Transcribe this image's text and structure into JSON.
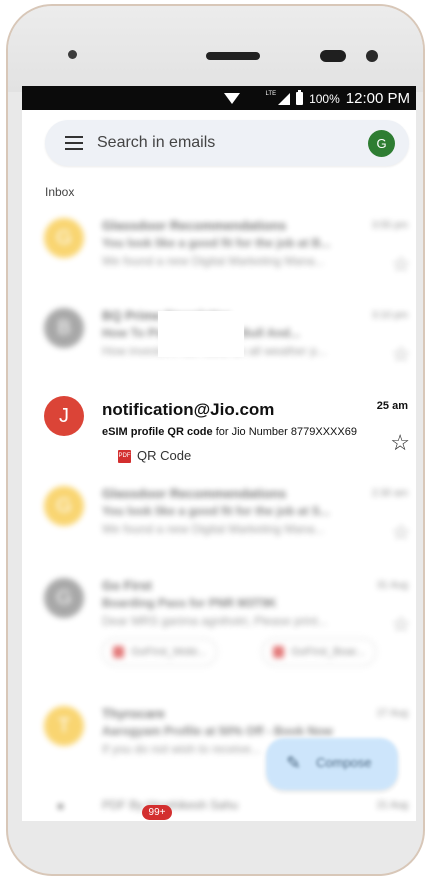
{
  "status_bar": {
    "lte": "LTE",
    "battery": "100%",
    "time": "12:00 PM"
  },
  "search": {
    "placeholder": "Search in emails",
    "avatar_initial": "G"
  },
  "section_label": "Inbox",
  "emails": [
    {
      "avatar": "G",
      "avatar_color": "#f6bf26",
      "sender": "Glassdoor Recommendations",
      "subject": "You look like a good fit for the job at B...",
      "snippet": "We found a new Digital Marketing Mana...",
      "time": "3:55 pm"
    },
    {
      "avatar": "B",
      "avatar_color": "#7a7a7a",
      "sender": "BQ Prime Newsletter",
      "subject": "How To Pick Stocks For Bull And...",
      "snippet": "How investors can build an all weather p...",
      "time": "3:10 pm"
    },
    {
      "avatar": "J",
      "avatar_color": "#db4437",
      "sender": "notification@Jio.com",
      "subject_bold": "eSIM profile QR code",
      "subject_rest": " for Jio Number 8779XXXX69",
      "attachment": "QR Code",
      "attachment_badge": "PDF",
      "time": "25 am"
    },
    {
      "avatar": "G",
      "avatar_color": "#f6bf26",
      "sender": "Glassdoor Recommendations",
      "subject": "You look like a good fit for the job at S...",
      "snippet": "We found a new Digital Marketing Mana...",
      "time": "2:30 am"
    },
    {
      "avatar": "G",
      "avatar_color": "#7a7a7a",
      "sender": "Go First",
      "subject": "Boarding Pass for PNR M3T9K",
      "snippet": "Dear MRS garima agnihotri, Please print...",
      "time": "31 Aug",
      "chips": [
        "GoFirst_Mobi...",
        "GoFirst_Boar..."
      ]
    },
    {
      "avatar": "T",
      "avatar_color": "#f6bf26",
      "sender": "Thyrocare",
      "subject": "Aarogyam Profile at 50% Off - Book Now",
      "snippet": "If you do not wish to receive...",
      "time": "27 Aug"
    }
  ],
  "partial_row": {
    "text": "PDF By Hrushikesh Sahu",
    "time": "21 Aug"
  },
  "compose": {
    "label": "Compose"
  },
  "badge_count": "99+"
}
